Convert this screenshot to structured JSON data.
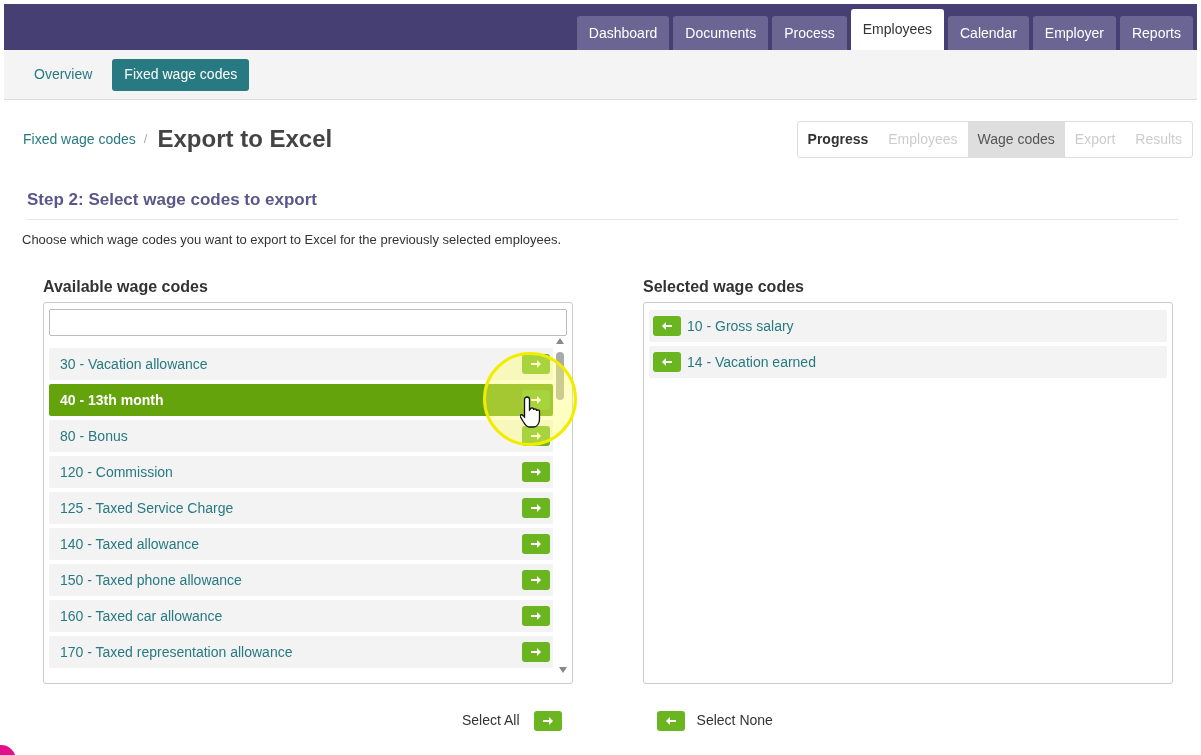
{
  "main_tabs": [
    {
      "label": "Dashboard",
      "selected": false
    },
    {
      "label": "Documents",
      "selected": false
    },
    {
      "label": "Process",
      "selected": false
    },
    {
      "label": "Employees",
      "selected": true
    },
    {
      "label": "Calendar",
      "selected": false
    },
    {
      "label": "Employer",
      "selected": false
    },
    {
      "label": "Reports",
      "selected": false
    }
  ],
  "sub_tabs": [
    {
      "label": "Overview",
      "selected": false
    },
    {
      "label": "Fixed wage codes",
      "selected": true
    }
  ],
  "breadcrumb": {
    "link": "Fixed wage codes",
    "separator": "/",
    "title": "Export to Excel"
  },
  "progress": [
    {
      "label": "Progress",
      "kind": "heading"
    },
    {
      "label": "Employees",
      "kind": "step",
      "selected": false
    },
    {
      "label": "Wage codes",
      "kind": "step",
      "selected": true
    },
    {
      "label": "Export",
      "kind": "step",
      "selected": false
    },
    {
      "label": "Results",
      "kind": "step",
      "selected": false
    }
  ],
  "step_title": "Step 2: Select wage codes to export",
  "description": "Choose which wage codes you want to export to Excel for the previously selected employees.",
  "available": {
    "title": "Available wage codes",
    "items": [
      {
        "label": "30 - Vacation allowance",
        "selected": false
      },
      {
        "label": "40 - 13th month",
        "selected": true
      },
      {
        "label": "80 - Bonus",
        "selected": false
      },
      {
        "label": "120 - Commission",
        "selected": false
      },
      {
        "label": "125 - Taxed Service Charge",
        "selected": false
      },
      {
        "label": "140 - Taxed allowance",
        "selected": false
      },
      {
        "label": "150 - Taxed phone allowance",
        "selected": false
      },
      {
        "label": "160 - Taxed car allowance",
        "selected": false
      },
      {
        "label": "170 - Taxed representation allowance",
        "selected": false
      }
    ]
  },
  "selected_codes": {
    "title": "Selected wage codes",
    "items": [
      {
        "label": "10 - Gross salary"
      },
      {
        "label": "14 - Vacation earned"
      }
    ]
  },
  "select_all": "Select All",
  "select_none": "Select None"
}
